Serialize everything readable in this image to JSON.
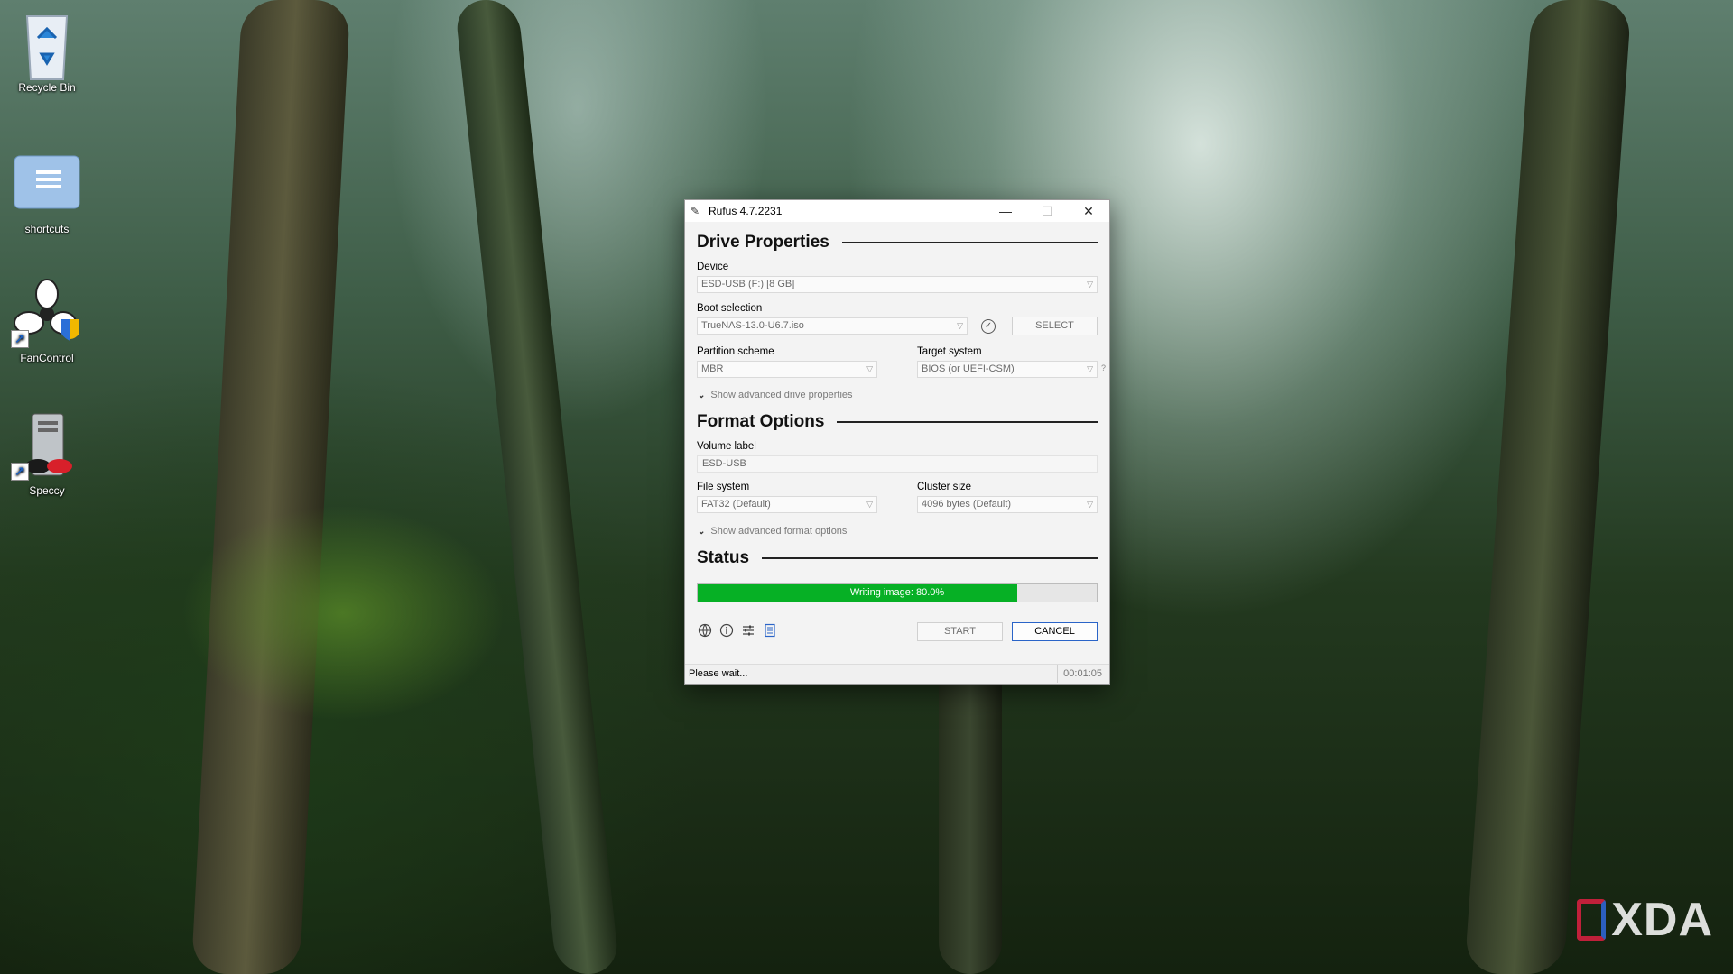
{
  "desktop": {
    "icons": [
      {
        "label": "Recycle Bin"
      },
      {
        "label": "shortcuts"
      },
      {
        "label": "FanControl"
      },
      {
        "label": "Speccy"
      }
    ],
    "watermark": "XDA"
  },
  "window": {
    "title": "Rufus 4.7.2231",
    "controls": {
      "minimize": "—",
      "maximize": "☐",
      "close": "✕"
    },
    "drive_properties": {
      "heading": "Drive Properties",
      "device_label": "Device",
      "device_value": "ESD-USB (F:) [8 GB]",
      "boot_selection_label": "Boot selection",
      "boot_selection_value": "TrueNAS-13.0-U6.7.iso",
      "select_button": "SELECT",
      "partition_scheme_label": "Partition scheme",
      "partition_scheme_value": "MBR",
      "target_system_label": "Target system",
      "target_system_value": "BIOS (or UEFI-CSM)",
      "target_help": "?",
      "advanced_toggle": "Show advanced drive properties"
    },
    "format_options": {
      "heading": "Format Options",
      "volume_label_label": "Volume label",
      "volume_label_value": "ESD-USB",
      "file_system_label": "File system",
      "file_system_value": "FAT32 (Default)",
      "cluster_size_label": "Cluster size",
      "cluster_size_value": "4096 bytes (Default)",
      "advanced_toggle": "Show advanced format options"
    },
    "status": {
      "heading": "Status",
      "progress_text": "Writing image: 80.0%",
      "progress_fraction": 0.8,
      "progress_color": "#06b025"
    },
    "toolbar_icons": [
      "language-icon",
      "info-icon",
      "settings-icon",
      "log-icon"
    ],
    "buttons": {
      "start": "START",
      "cancel": "CANCEL"
    },
    "statusbar": {
      "message": "Please wait...",
      "elapsed": "00:01:05"
    }
  }
}
